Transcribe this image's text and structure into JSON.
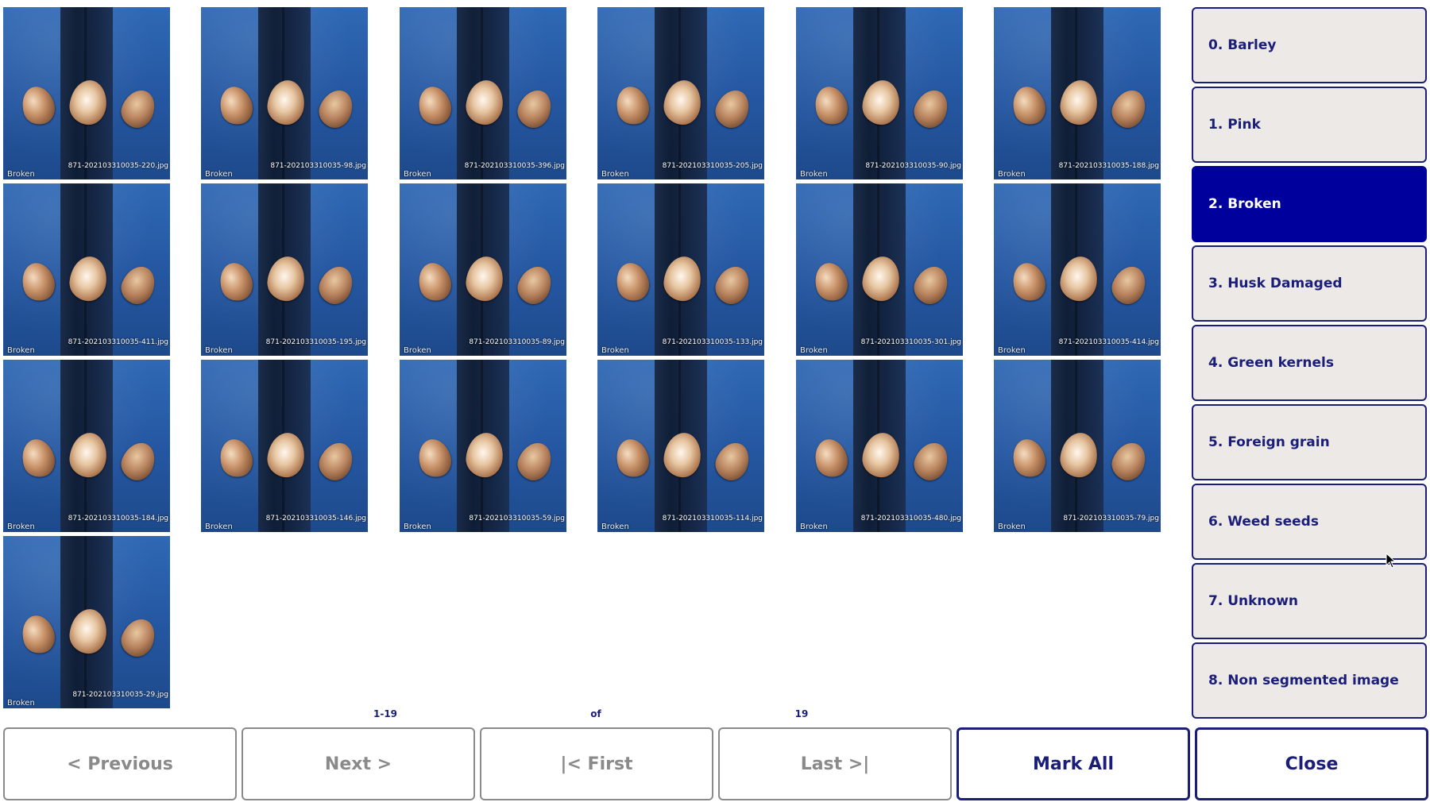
{
  "grid": {
    "tiles": [
      {
        "label": "Broken",
        "filename": "871-202103310035-220.jpg"
      },
      {
        "label": "Broken",
        "filename": "871-202103310035-98.jpg"
      },
      {
        "label": "Broken",
        "filename": "871-202103310035-396.jpg"
      },
      {
        "label": "Broken",
        "filename": "871-202103310035-205.jpg"
      },
      {
        "label": "Broken",
        "filename": "871-202103310035-90.jpg"
      },
      {
        "label": "Broken",
        "filename": "871-202103310035-188.jpg"
      },
      {
        "label": "Broken",
        "filename": "871-202103310035-411.jpg"
      },
      {
        "label": "Broken",
        "filename": "871-202103310035-195.jpg"
      },
      {
        "label": "Broken",
        "filename": "871-202103310035-89.jpg"
      },
      {
        "label": "Broken",
        "filename": "871-202103310035-133.jpg"
      },
      {
        "label": "Broken",
        "filename": "871-202103310035-301.jpg"
      },
      {
        "label": "Broken",
        "filename": "871-202103310035-414.jpg"
      },
      {
        "label": "Broken",
        "filename": "871-202103310035-184.jpg"
      },
      {
        "label": "Broken",
        "filename": "871-202103310035-146.jpg"
      },
      {
        "label": "Broken",
        "filename": "871-202103310035-59.jpg"
      },
      {
        "label": "Broken",
        "filename": "871-202103310035-114.jpg"
      },
      {
        "label": "Broken",
        "filename": "871-202103310035-480.jpg"
      },
      {
        "label": "Broken",
        "filename": "871-202103310035-79.jpg"
      },
      {
        "label": "Broken",
        "filename": "871-202103310035-29.jpg"
      }
    ]
  },
  "categories": [
    {
      "label": "0. Barley",
      "selected": false
    },
    {
      "label": "1. Pink",
      "selected": false
    },
    {
      "label": "2. Broken",
      "selected": true
    },
    {
      "label": "3. Husk Damaged",
      "selected": false
    },
    {
      "label": "4. Green kernels",
      "selected": false
    },
    {
      "label": "5. Foreign grain",
      "selected": false
    },
    {
      "label": "6. Weed seeds",
      "selected": false
    },
    {
      "label": "7. Unknown",
      "selected": false
    },
    {
      "label": "8. Non segmented image",
      "selected": false
    }
  ],
  "pager": {
    "range": "1-19",
    "of_label": "of",
    "total": "19"
  },
  "buttons": {
    "previous": "< Previous",
    "next": "Next >",
    "first": "|< First",
    "last": "Last >|",
    "mark_all": "Mark All",
    "close": "Close"
  },
  "colors": {
    "accent": "#1a1e78",
    "selected_bg": "#00009c",
    "category_bg": "#ede9e6",
    "disabled_text": "#8a8a8a"
  }
}
